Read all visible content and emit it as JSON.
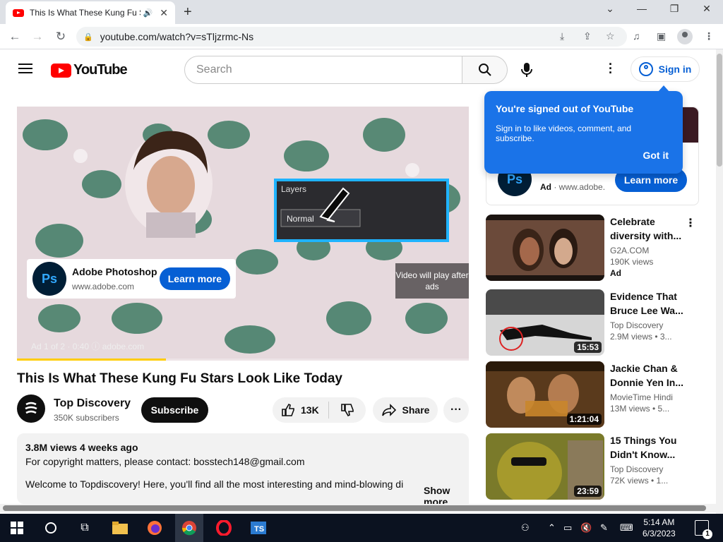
{
  "browser": {
    "tab_title": "This Is What These Kung Fu Stars Look Like Today",
    "url": "youtube.com/watch?v=sTljzrmc-Ns"
  },
  "header": {
    "logo_text": "YouTube",
    "search_placeholder": "Search",
    "signin_label": "Sign in"
  },
  "player": {
    "ad_name": "Adobe Photoshop",
    "ad_url": "www.adobe.com",
    "ad_logo": "Ps",
    "ad_learn_more": "Learn more",
    "video_will_play": "Video will play after ads",
    "ad_meta": "Ad 1 of 2 · 0:40  ⓘ  adobe.com",
    "ad_progress": 0.33,
    "layers_panel_title": "Layers",
    "layers_blend_mode": "Normal"
  },
  "video": {
    "title": "This Is What These Kung Fu Stars Look Like Today",
    "channel": "Top Discovery",
    "subscribers": "350K subscribers",
    "subscribe_label": "Subscribe",
    "likes": "13K",
    "share_label": "Share",
    "description_meta": "3.8M views  4 weeks ago",
    "description_line1": "For copyright matters, please contact: bosstech148@gmail.com",
    "description_line2": "Welcome to Topdiscovery! Here, you'll find all the most interesting and mind-blowing di",
    "show_more": "Show more"
  },
  "tooltip": {
    "title": "You're signed out of YouTube",
    "body": "Sign in to like videos, comment, and subscribe.",
    "got_it": "Got it"
  },
  "side_ad": {
    "logo": "Ps",
    "ad_label": "Ad",
    "ad_domain": "www.adobe.",
    "learn_more": "Learn more"
  },
  "recommendations": [
    {
      "title": "Celebrate diversity with...",
      "channel": "G2A.COM",
      "views": "190K views",
      "ad": "Ad",
      "duration": ""
    },
    {
      "title": "Evidence That Bruce Lee Wa...",
      "channel": "Top Discovery",
      "views": "2.9M views  • 3...",
      "ad": "",
      "duration": "15:53"
    },
    {
      "title": "Jackie Chan & Donnie Yen In...",
      "channel": "MovieTime Hindi",
      "views": "13M views  • 5...",
      "ad": "",
      "duration": "1:21:04"
    },
    {
      "title": "15 Things You Didn't Know...",
      "channel": "Top Discovery",
      "views": "72K views  • 1...",
      "ad": "",
      "duration": "23:59"
    }
  ],
  "taskbar": {
    "time": "5:14 AM",
    "date": "6/3/2023",
    "notifications": "1"
  },
  "colors": {
    "youtube_red": "#ff0000",
    "link_blue": "#065fd4",
    "tooltip_blue": "#1a73e8"
  }
}
